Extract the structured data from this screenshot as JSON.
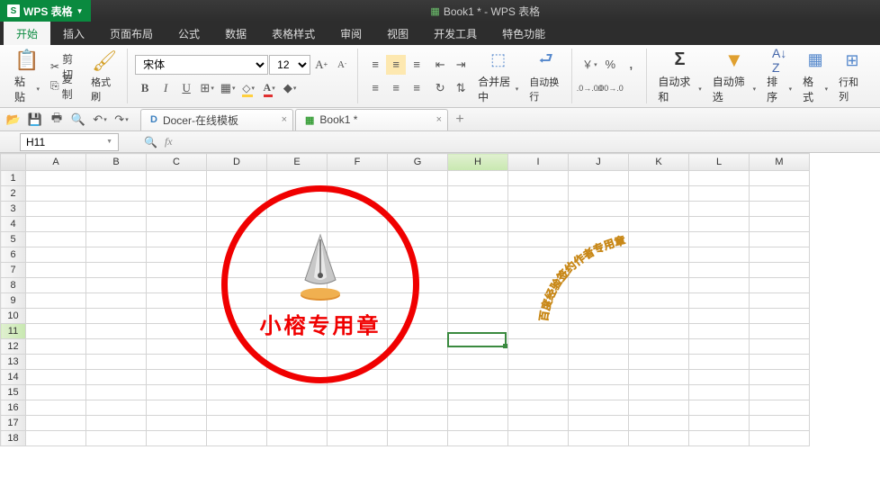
{
  "app": {
    "name": "WPS 表格",
    "title_doc": "Book1 * - WPS 表格"
  },
  "menu": {
    "tabs": [
      "开始",
      "插入",
      "页面布局",
      "公式",
      "数据",
      "表格样式",
      "审阅",
      "视图",
      "开发工具",
      "特色功能"
    ],
    "active": 0
  },
  "ribbon": {
    "paste": "粘贴",
    "cut": "剪切",
    "copy": "复制",
    "format_painter": "格式刷",
    "font_name": "宋体",
    "font_size": "12",
    "merge_center": "合并居中",
    "wrap_text": "自动换行",
    "auto_sum": "自动求和",
    "auto_filter": "自动筛选",
    "sort": "排序",
    "format": "格式",
    "row_col": "行和列",
    "currency": "￥",
    "percent": "%"
  },
  "doc_tabs": [
    {
      "icon": "D",
      "icon_color": "#3a7fbf",
      "label": "Docer-在线模板"
    },
    {
      "icon": "▦",
      "icon_color": "#3a9f3a",
      "label": "Book1 *"
    }
  ],
  "formula_bar": {
    "cell_ref": "H11",
    "fx": "fx"
  },
  "grid": {
    "columns": [
      "A",
      "B",
      "C",
      "D",
      "E",
      "F",
      "G",
      "H",
      "I",
      "J",
      "K",
      "L",
      "M"
    ],
    "rows": 18,
    "selected_col_index": 7,
    "selected_row_index": 10,
    "selected_cell": "H11"
  },
  "stamp": {
    "text": "小榕专用章"
  },
  "arc_text": {
    "chars": [
      "百",
      "度",
      "经",
      "验",
      "签",
      "约",
      "作",
      "者",
      "专",
      "用",
      "章"
    ]
  }
}
